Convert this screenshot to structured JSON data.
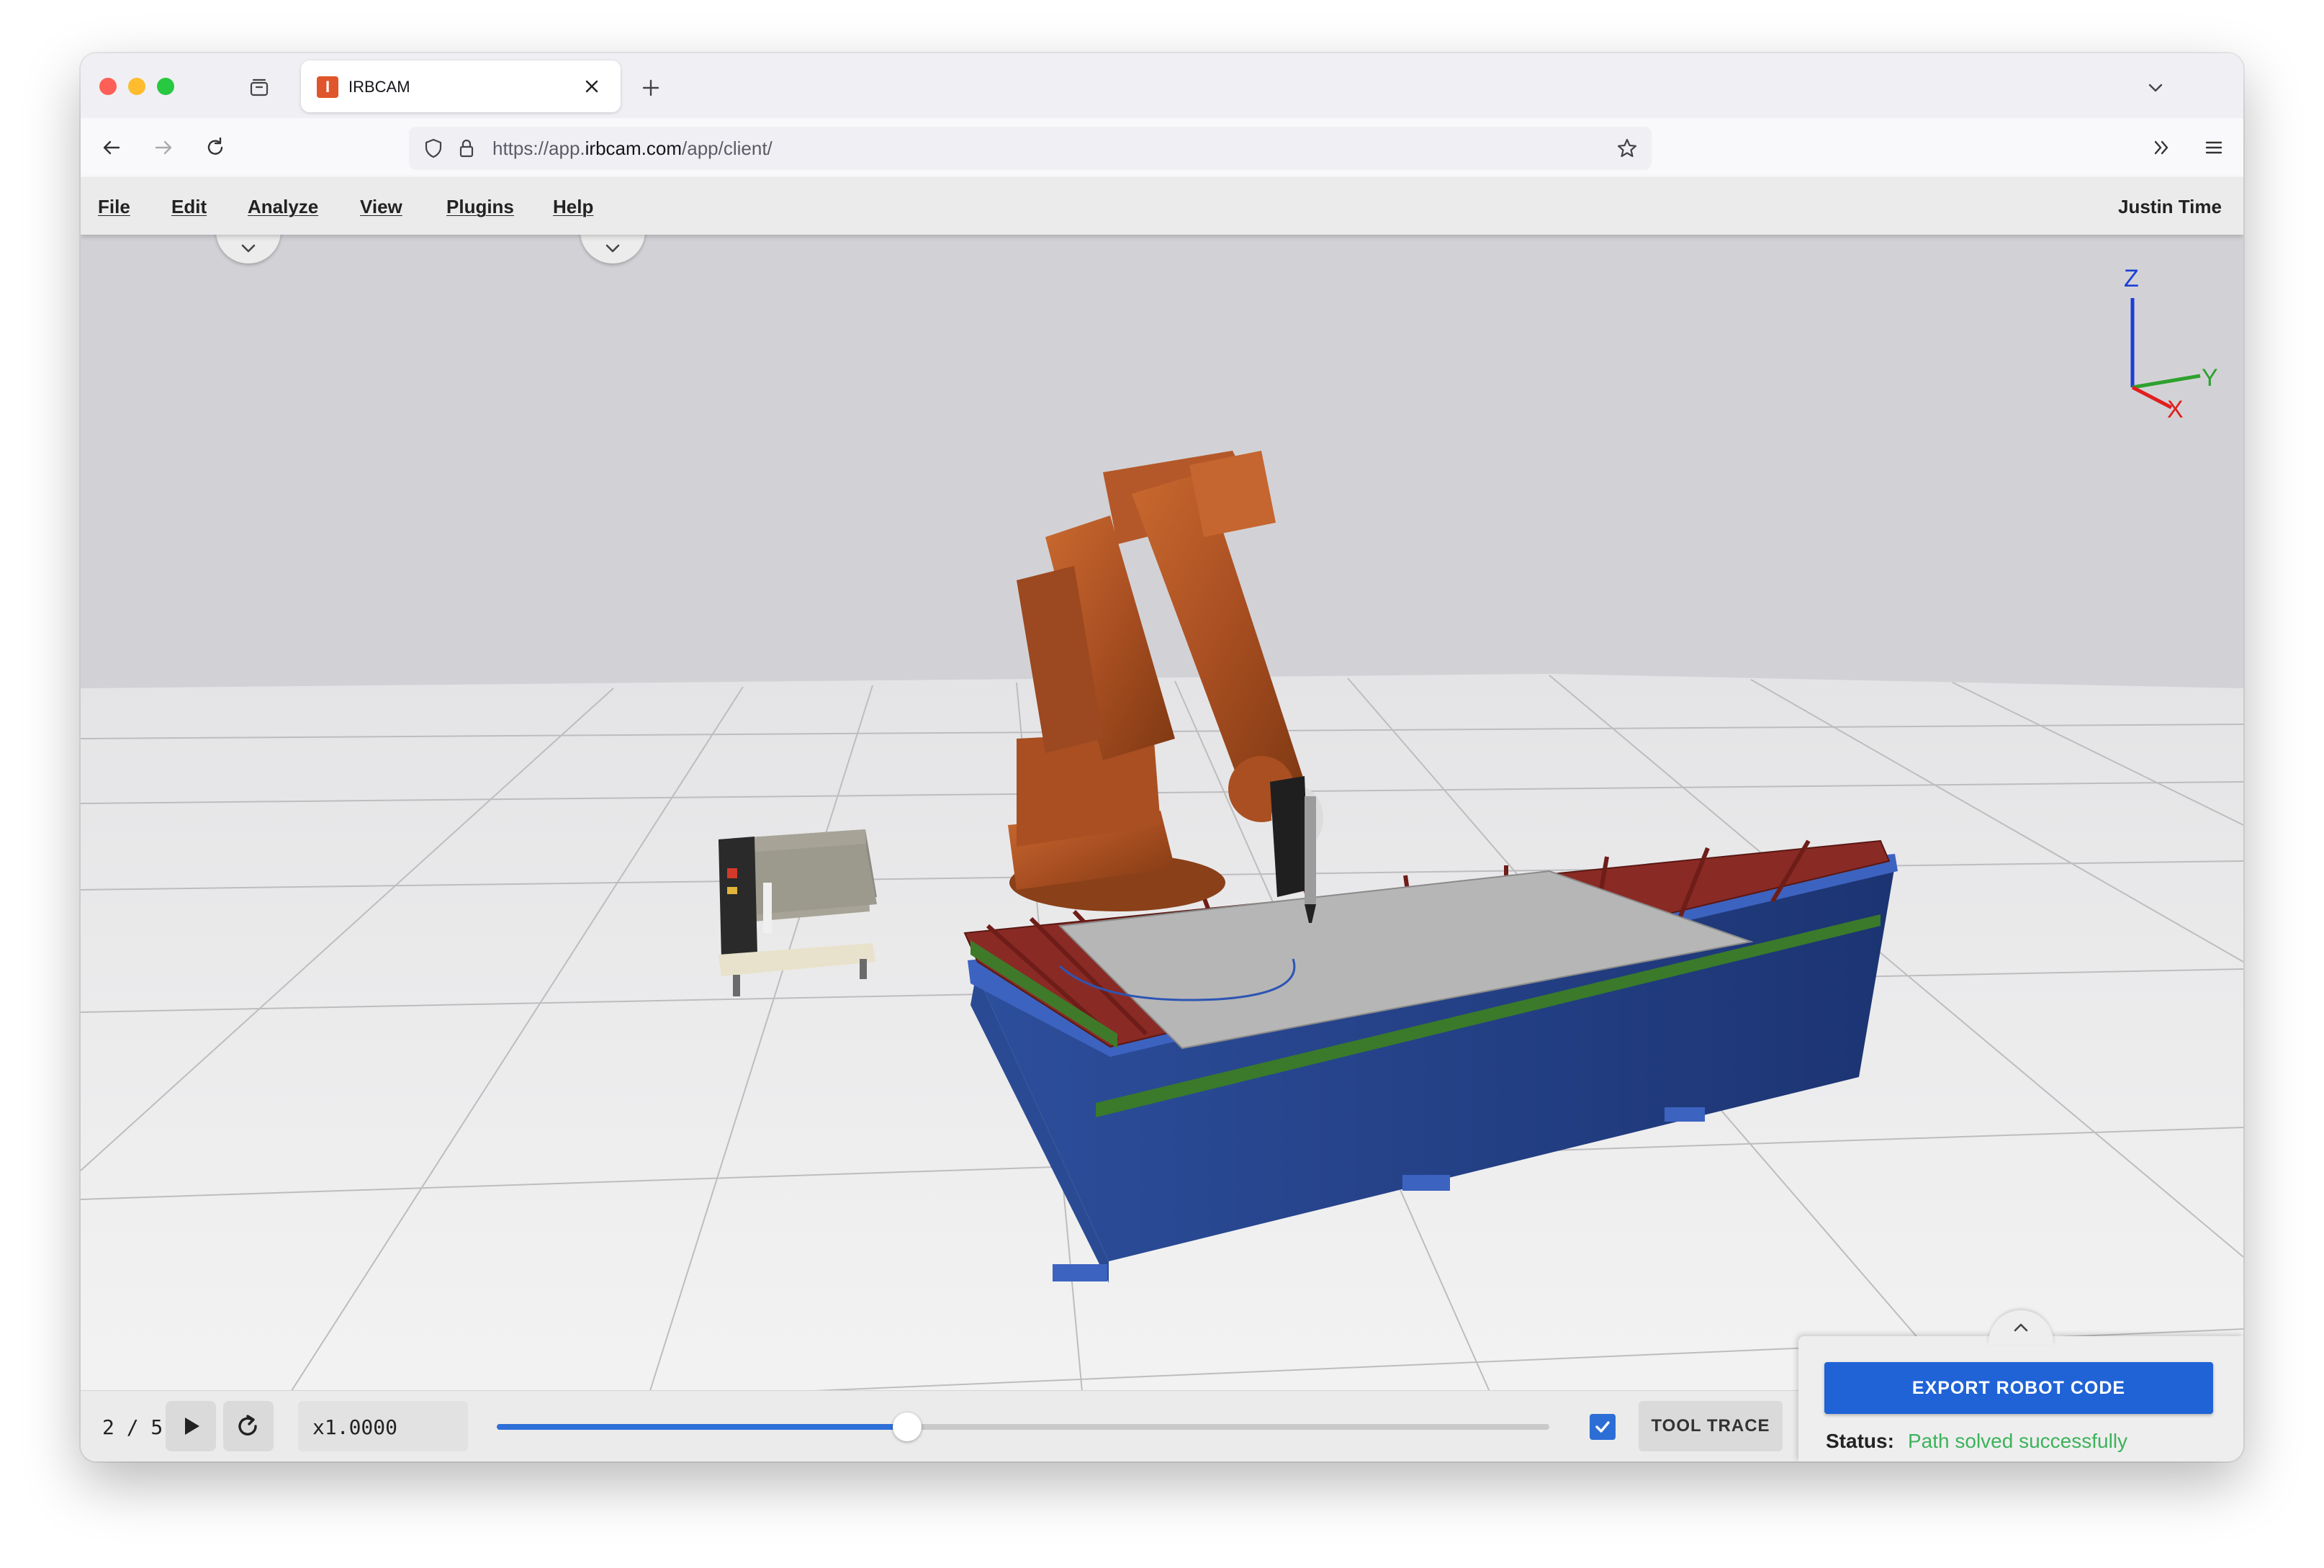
{
  "browser": {
    "tab": {
      "title": "IRBCAM",
      "favicon_icon": "irbcam-logo-icon"
    },
    "url": {
      "prefix": "https://app.",
      "domain": "irbcam.com",
      "path": "/app/client/"
    }
  },
  "menu": {
    "items": [
      {
        "label": "File",
        "name": "menu-file"
      },
      {
        "label": "Edit",
        "name": "menu-edit"
      },
      {
        "label": "Analyze",
        "name": "menu-analyze"
      },
      {
        "label": "View",
        "name": "menu-view"
      },
      {
        "label": "Plugins",
        "name": "menu-plugins"
      },
      {
        "label": "Help",
        "name": "menu-help"
      }
    ],
    "user": "Justin Time"
  },
  "axes": {
    "z": "Z",
    "y": "Y",
    "x": "X",
    "colors": {
      "z": "#1a3fd6",
      "y": "#2ea12e",
      "x": "#e02020"
    }
  },
  "player": {
    "frame": "2 / 5",
    "speed": "x1.0000",
    "progress": 0.39,
    "tool_trace_checked": true,
    "tool_trace_label": "TOOL TRACE"
  },
  "export": {
    "button_label": "EXPORT ROBOT CODE",
    "status_label": "Status:",
    "status_value": "Path solved successfully",
    "status_color": "#3cb35a"
  },
  "colors": {
    "accent": "#1f63d6",
    "robot": "#b4582a",
    "table_base": "#1e3a78"
  }
}
